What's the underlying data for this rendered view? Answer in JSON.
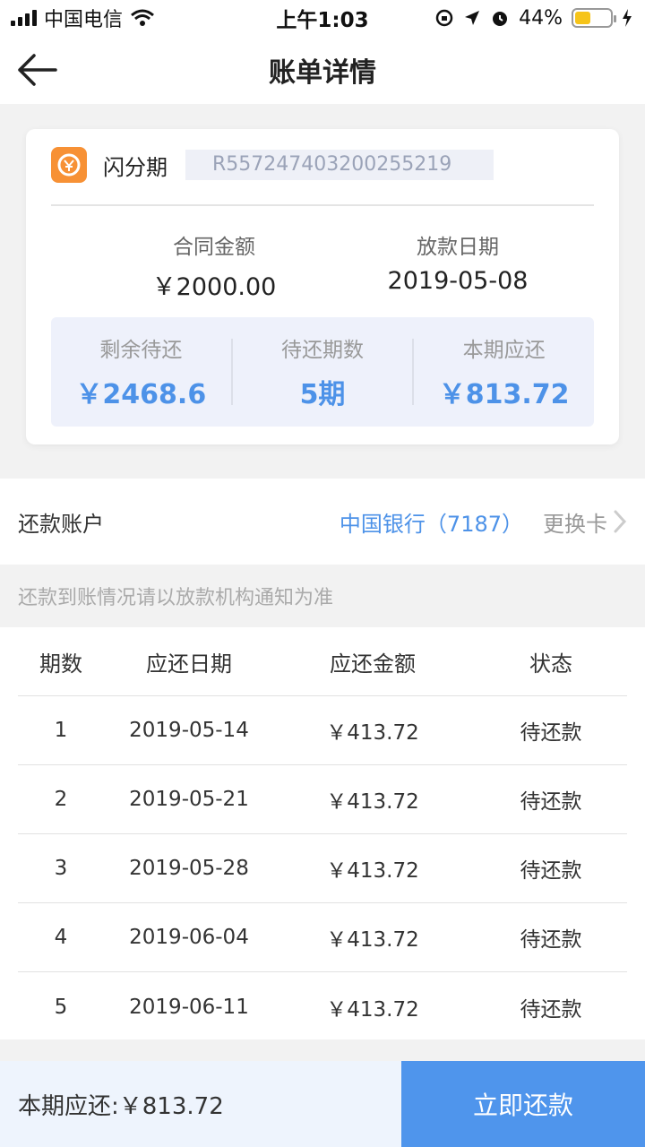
{
  "status_bar": {
    "carrier": "中国电信",
    "time": "上午1:03",
    "battery_percent": "44%",
    "battery_level": 0.44
  },
  "header": {
    "title": "账单详情"
  },
  "loan_card": {
    "product_name": "闪分期",
    "contract_no": "R557247403200255219",
    "contract_amount_label": "合同金额",
    "contract_amount": "￥2000.00",
    "disburse_date_label": "放款日期",
    "disburse_date": "2019-05-08",
    "summary": [
      {
        "label": "剩余待还",
        "value": "￥2468.6"
      },
      {
        "label": "待还期数",
        "value": "5期"
      },
      {
        "label": "本期应还",
        "value": "￥813.72"
      }
    ]
  },
  "account": {
    "label": "还款账户",
    "bank": "中国银行（7187）",
    "change_label": "更换卡"
  },
  "notice": "还款到账情况请以放款机构通知为准",
  "schedule": {
    "headers": [
      "期数",
      "应还日期",
      "应还金额",
      "状态"
    ],
    "rows": [
      {
        "period": "1",
        "date": "2019-05-14",
        "amount": "￥413.72",
        "status": "待还款"
      },
      {
        "period": "2",
        "date": "2019-05-21",
        "amount": "￥413.72",
        "status": "待还款"
      },
      {
        "period": "3",
        "date": "2019-05-28",
        "amount": "￥413.72",
        "status": "待还款"
      },
      {
        "period": "4",
        "date": "2019-06-04",
        "amount": "￥413.72",
        "status": "待还款"
      },
      {
        "period": "5",
        "date": "2019-06-11",
        "amount": "￥413.72",
        "status": "待还款"
      }
    ]
  },
  "footer": {
    "due_text": "本期应还:￥813.72",
    "pay_button": "立即还款"
  },
  "colors": {
    "accent": "#4d92e8",
    "logo": "#f79135"
  }
}
